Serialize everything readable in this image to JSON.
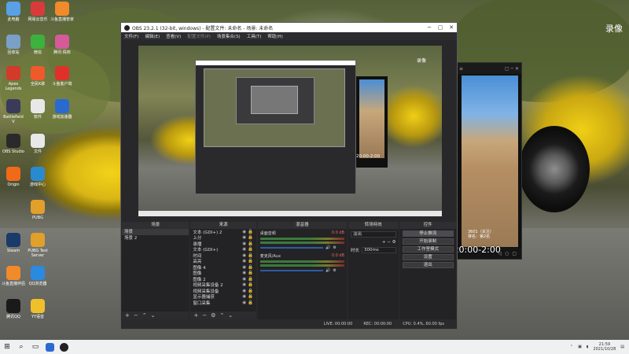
{
  "desktop": {
    "watermark": "录像",
    "icons": [
      {
        "label": "此电脑",
        "color": "#5aa0e6"
      },
      {
        "label": "网易云音乐",
        "color": "#d93b3b"
      },
      {
        "label": "斗鱼直播管家",
        "color": "#f08a2a"
      },
      {
        "label": "回收站",
        "color": "#7aa0c8"
      },
      {
        "label": "微信",
        "color": "#3db13d"
      },
      {
        "label": "腾讯·情商",
        "color": "#d45a9a"
      },
      {
        "label": "Apex Legends",
        "color": "#d23a2a"
      },
      {
        "label": "全民K歌",
        "color": "#f05a2a"
      },
      {
        "label": "斗鱼客户端",
        "color": "#e0302a"
      },
      {
        "label": "Battlefield V",
        "color": "#3a3a5a"
      },
      {
        "label": "软件",
        "color": "#e8e8e8"
      },
      {
        "label": "游戏加速器",
        "color": "#2a6ad0"
      },
      {
        "label": "OBS Studio",
        "color": "#2a2a2a"
      },
      {
        "label": "文件",
        "color": "#e8e8e8"
      },
      {
        "label": "Origin",
        "color": "#f06a1a"
      },
      {
        "label": "游戏中心",
        "color": "#2a8ad0"
      },
      {
        "label": "PUBG",
        "color": "#e0a02a"
      },
      {
        "label": "Steam",
        "color": "#1a3a6a"
      },
      {
        "label": "PUBG Test Server",
        "color": "#e0a02a"
      },
      {
        "label": "斗鱼直播伴侣",
        "color": "#f08a2a"
      },
      {
        "label": "QQ浏览器",
        "color": "#2a8ae0"
      },
      {
        "label": "腾讯QQ",
        "color": "#1a1a1a"
      },
      {
        "label": "YY语音",
        "color": "#f0c02a"
      }
    ]
  },
  "overlay": {
    "followers_label": "3601（关注）",
    "rank_label": "排名：第2名",
    "new_time": "新时间：  20:00-2:00"
  },
  "obs": {
    "title": "OBS 23.2.1 (32-bit, windows) - 配置文件: 未命名 - 场景: 未命名",
    "menu": [
      "文件(F)",
      "编辑(E)",
      "查看(V)",
      "配置文件(P)",
      "场景集合(S)",
      "工具(T)",
      "帮助(H)"
    ],
    "preview_label": "录像",
    "preview_time": "20:00-2:00",
    "scenes": {
      "header": "场景",
      "items": [
        "场景",
        "场景 2"
      ]
    },
    "sources": {
      "header": "来源",
      "items": [
        "文本 (GDI+) 2",
        "上分",
        "录播",
        "文本 (GDI+)",
        "时间",
        "高亮",
        "图像 4",
        "图像",
        "图像 2",
        "视频采集设备 2",
        "视频采集设备",
        "显示器捕获",
        "窗口采集"
      ]
    },
    "mixer": {
      "header": "混音器",
      "channels": [
        {
          "name": "桌面音频",
          "db": "0.0 dB"
        },
        {
          "name": "麦克风/Aux",
          "db": "0.0 dB"
        }
      ]
    },
    "transitions": {
      "header": "转场特效",
      "type": "淡出",
      "duration_label": "时长",
      "duration": "300ms"
    },
    "controls": {
      "header": "控件",
      "buttons": [
        "停止推流",
        "开始录制",
        "工作室模式",
        "设置",
        "退出"
      ]
    },
    "status": {
      "live": "LIVE: 00:00:00",
      "rec": "REC: 00:00:00",
      "cpu": "CPU: 0.4%, 60.00 fps"
    }
  },
  "taskbar": {
    "time": "21:59",
    "date": "2021/10/28"
  }
}
